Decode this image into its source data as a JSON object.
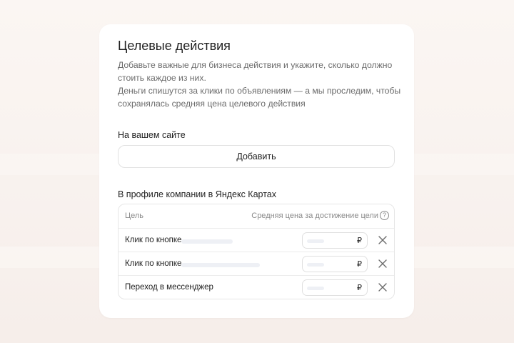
{
  "card": {
    "title": "Целевые действия",
    "description": [
      "Добавьте важные для бизнеса действия и укажите, сколько должно стоить каждое из них.",
      "Деньги спишутся за клики по объявлениям — а мы проследим, чтобы сохранялась средняя цена целевого действия"
    ]
  },
  "site_section": {
    "label": "На вашем сайте",
    "add_button": "Добавить"
  },
  "maps_section": {
    "label": "В профиле компании в Яндекс Картах",
    "table": {
      "col_goal": "Цель",
      "col_price": "Средняя цена за достижение цели",
      "help": "?",
      "rows": [
        {
          "name": "Клик по кнопке",
          "currency": "₽"
        },
        {
          "name": "Клик по кнопке",
          "currency": "₽"
        },
        {
          "name": "Переход в мессенджер",
          "currency": "₽"
        }
      ]
    }
  },
  "colors": {
    "background": "#f7f1ee",
    "card": "#ffffff",
    "text": "#1f1f1f",
    "muted": "#6b6b6b",
    "border": "#e2e2e2",
    "skeleton": "#eef0f5"
  },
  "icons": {
    "help": "question-circle-icon",
    "remove": "close-icon"
  }
}
